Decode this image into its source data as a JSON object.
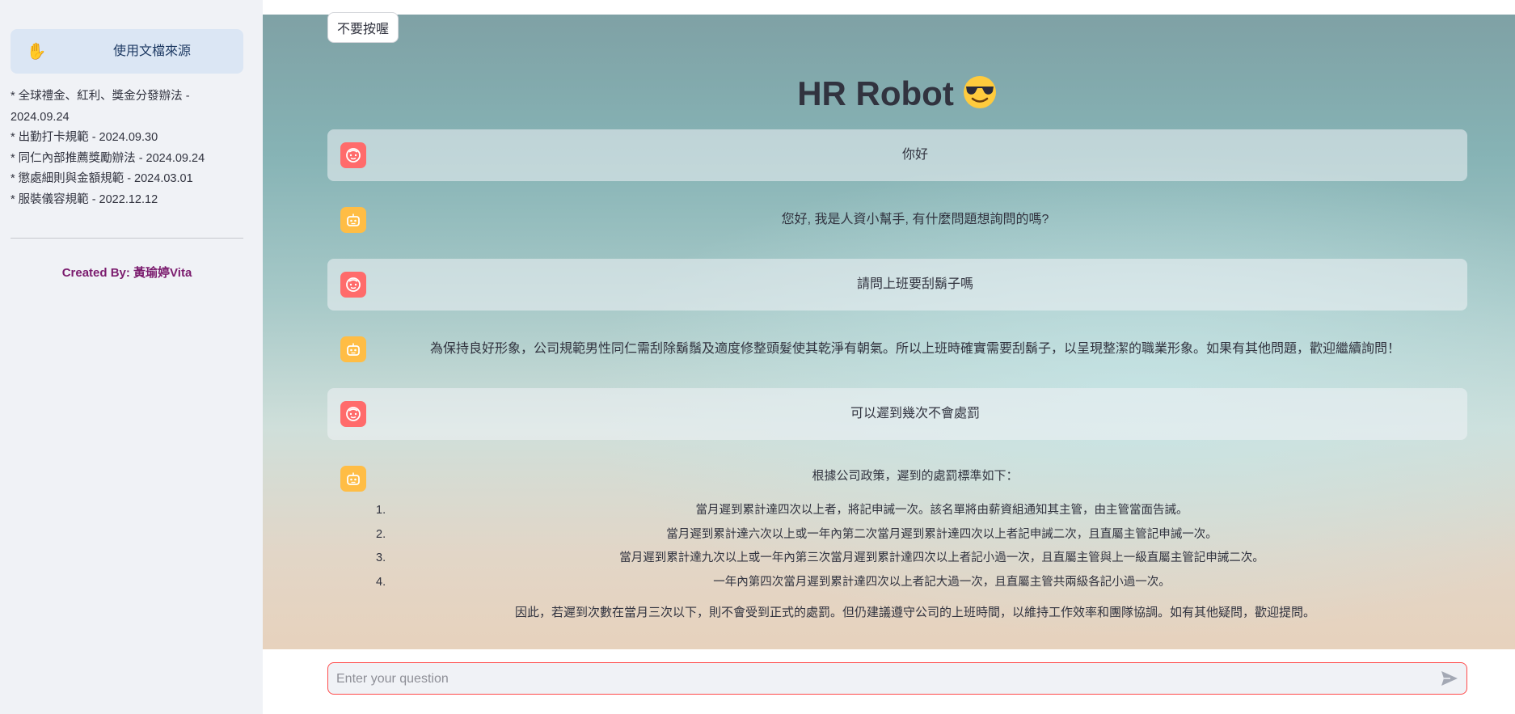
{
  "sidebar": {
    "source_button_label": "使用文檔來源",
    "source_icon": "waving-hand-icon",
    "documents": [
      "* 全球禮金、紅利、獎金分發辦法 - 2024.09.24",
      "* 出勤打卡規範 - 2024.09.30",
      "* 同仁內部推薦獎勵辦法 - 2024.09.24",
      "* 懲處細則與金額規範 - 2024.03.01",
      "* 服裝儀容規範 - 2022.12.12"
    ],
    "credit_prefix": "Created By: ",
    "credit_name": "黃瑜婷Vita"
  },
  "main": {
    "no_press_button": "不要按喔",
    "title": "HR Robot",
    "title_icon": "smiling-face-with-sunglasses-icon"
  },
  "chat": {
    "messages": [
      {
        "role": "user",
        "text": "你好"
      },
      {
        "role": "assistant",
        "text": "您好, 我是人資小幫手, 有什麼問題想詢問的嗎?"
      },
      {
        "role": "user",
        "text": "請問上班要刮鬍子嗎"
      },
      {
        "role": "assistant",
        "text": "為保持良好形象，公司規範男性同仁需刮除鬍鬚及適度修整頭髮使其乾淨有朝氣。所以上班時確實需要刮鬍子，以呈現整潔的職業形象。如果有其他問題，歡迎繼續詢問！"
      },
      {
        "role": "user",
        "text": "可以遲到幾次不會處罰"
      },
      {
        "role": "assistant",
        "intro": "根據公司政策，遲到的處罰標準如下：",
        "list": [
          {
            "num": "1.",
            "text": "當月遲到累計達四次以上者，將記申誡一次。該名單將由薪資組通知其主管，由主管當面告誡。"
          },
          {
            "num": "2.",
            "text": "當月遲到累計達六次以上或一年內第二次當月遲到累計達四次以上者記申誡二次，且直屬主管記申誡一次。"
          },
          {
            "num": "3.",
            "text": "當月遲到累計達九次以上或一年內第三次當月遲到累計達四次以上者記小過一次，且直屬主管與上一級直屬主管記申誡二次。"
          },
          {
            "num": "4.",
            "text": "一年內第四次當月遲到累計達四次以上者記大過一次，且直屬主管共兩級各記小過一次。"
          }
        ],
        "outro": "因此，若遲到次數在當月三次以下，則不會受到正式的處罰。但仍建議遵守公司的上班時間，以維持工作效率和團隊協調。如有其他疑問，歡迎提問。"
      }
    ],
    "user_avatar_icon": "user-face-icon",
    "assistant_avatar_icon": "robot-face-icon"
  },
  "input": {
    "placeholder": "Enter your question",
    "value": "",
    "send_icon": "send-arrow-icon"
  },
  "colors": {
    "sidebar_bg": "#f0f2f6",
    "user_avatar": "#ff6b6b",
    "assistant_avatar": "#ffbd45",
    "credit": "#7b1c6e",
    "input_border": "#ff4b4b"
  }
}
